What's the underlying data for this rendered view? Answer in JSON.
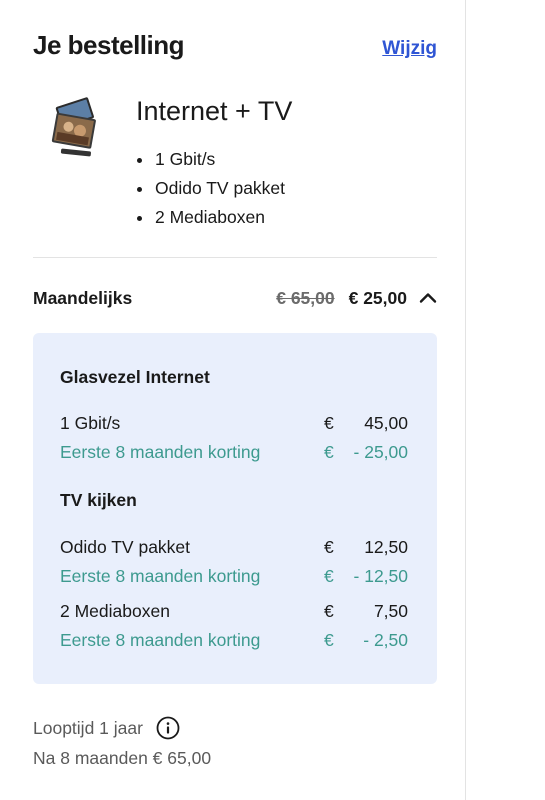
{
  "header": {
    "title": "Je bestelling",
    "edit_label": "Wijzig"
  },
  "product": {
    "name": "Internet + TV",
    "features": [
      "1 Gbit/s",
      "Odido TV pakket",
      "2 Mediaboxen"
    ]
  },
  "monthly": {
    "label": "Maandelijks",
    "old_price": "€ 65,00",
    "new_price": "€ 25,00",
    "expanded": true
  },
  "breakdown": {
    "sections": [
      {
        "title": "Glasvezel Internet",
        "lines": [
          {
            "desc": "1 Gbit/s",
            "currency": "€",
            "amount": "45,00",
            "discount": false
          },
          {
            "desc": "Eerste 8 maanden korting",
            "currency": "€",
            "amount": "- 25,00",
            "discount": true
          }
        ]
      },
      {
        "title": "TV kijken",
        "lines": [
          {
            "desc": "Odido TV pakket",
            "currency": "€",
            "amount": "12,50",
            "discount": false
          },
          {
            "desc": "Eerste 8 maanden korting",
            "currency": "€",
            "amount": "- 12,50",
            "discount": true
          },
          {
            "desc": "2 Mediaboxen",
            "currency": "€",
            "amount": "7,50",
            "discount": false
          },
          {
            "desc": "Eerste 8 maanden korting",
            "currency": "€",
            "amount": "- 2,50",
            "discount": true
          }
        ]
      }
    ]
  },
  "term": {
    "label": "Looptijd 1 jaar",
    "after_label": "Na 8 maanden € 65,00"
  },
  "colors": {
    "accent_link": "#2f55d4",
    "discount": "#3d9a8f",
    "breakdown_bg": "#e9effc"
  }
}
